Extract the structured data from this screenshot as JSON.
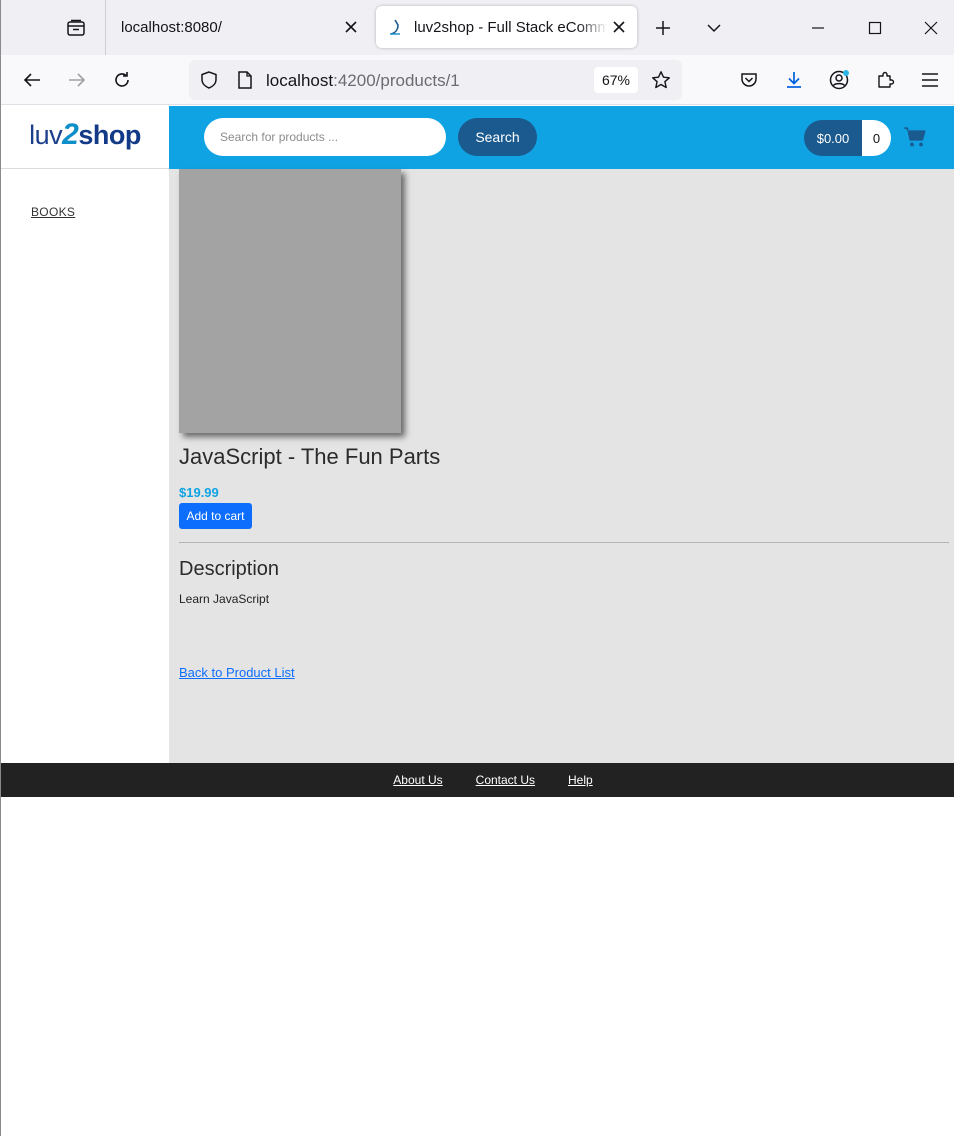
{
  "browser": {
    "tabs": [
      {
        "title": "localhost:8080/",
        "active": false
      },
      {
        "title": "luv2shop - Full Stack eCommerce",
        "active": true
      }
    ],
    "url": {
      "host": "localhost",
      "path": ":4200/products/1"
    },
    "zoom": "67%",
    "icons": {
      "tab_overview": "tab-overview-icon",
      "close": "close-icon",
      "new_tab": "plus-icon",
      "tab_list": "chevron-down-icon",
      "minimize": "minimize-icon",
      "maximize": "maximize-icon",
      "window_close": "close-icon",
      "back": "back-arrow-icon",
      "forward": "forward-arrow-icon",
      "reload": "reload-icon",
      "tracking": "shield-icon",
      "page": "page-icon",
      "bookmark": "star-icon",
      "pocket": "pocket-icon",
      "downloads": "download-icon",
      "account": "account-icon",
      "extensions": "puzzle-icon",
      "menu": "hamburger-menu-icon"
    }
  },
  "site": {
    "logo": {
      "part1": "luv",
      "part2": "2",
      "part3": "shop"
    },
    "search": {
      "placeholder": "Search for products ...",
      "button_label": "Search"
    },
    "cart": {
      "total": "$0.00",
      "quantity": "0",
      "icon": "shopping-cart-icon"
    },
    "colors": {
      "header": "#10a3e3",
      "accent_dark": "#1b5a8f",
      "button_blue": "#0d6efd",
      "footer": "#222222"
    }
  },
  "sidebar": {
    "categories": [
      {
        "label": "BOOKS"
      }
    ]
  },
  "product": {
    "name": "JavaScript - The Fun Parts",
    "price": "$19.99",
    "add_to_cart_label": "Add to cart",
    "description_heading": "Description",
    "description": "Learn JavaScript",
    "back_link": "Back to Product List"
  },
  "footer": {
    "links": [
      {
        "label": "About Us"
      },
      {
        "label": "Contact Us"
      },
      {
        "label": "Help"
      }
    ]
  }
}
